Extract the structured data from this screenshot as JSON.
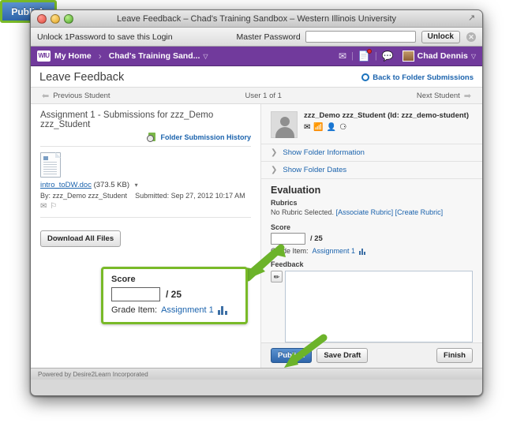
{
  "window": {
    "title": "Leave Feedback – Chad's Training Sandbox – Western Illinois University",
    "resize_icon": "resize-icon",
    "traffic_lights": [
      "close",
      "minimize",
      "zoom"
    ]
  },
  "onepassword_bar": {
    "message": "Unlock 1Password to save this Login",
    "master_password_label": "Master Password",
    "master_password_value": "",
    "unlock_label": "Unlock",
    "close_label": "✕"
  },
  "navbar": {
    "logo_text": "WIU",
    "home_label": "My Home",
    "separator": "›",
    "course_label": "Chad's Training Sand...",
    "course_caret": "▽",
    "icons": [
      "envelope-icon",
      "notifications-icon",
      "chat-icon"
    ],
    "notification_badge": true,
    "user_name": "Chad Dennis",
    "user_caret": "▽",
    "background_color": "#713a9c"
  },
  "page": {
    "title": "Leave Feedback",
    "back_link": "Back to Folder Submissions",
    "student_bar": {
      "previous": "Previous Student",
      "counter": "User 1 of 1",
      "next": "Next Student"
    }
  },
  "left_panel": {
    "assignment_title": "Assignment 1 - Submissions for zzz_Demo zzz_Student",
    "history_link": "Folder Submission History",
    "file_name": "intro_toDW.doc",
    "file_size": "(373.5 KB)",
    "file_caret": "▾",
    "submitted_by": "By: zzz_Demo zzz_Student",
    "submitted_on": "Submitted: Sep 27, 2012 10:17 AM",
    "download_all_label": "Download All Files"
  },
  "right_panel": {
    "student_name": "zzz_Demo zzz_Student (Id: zzz_demo-student)",
    "student_icons": [
      "email-icon",
      "pager-icon",
      "profile-icon",
      "refresh-icon"
    ],
    "show_folder_information": "Show Folder Information",
    "show_folder_dates": "Show Folder Dates",
    "evaluation_heading": "Evaluation",
    "rubrics_label": "Rubrics",
    "no_rubric_text": "No Rubric Selected.",
    "associate_rubric": "[Associate Rubric]",
    "create_rubric": "[Create Rubric]",
    "score_label": "Score",
    "score_value": "",
    "score_max": "/ 25",
    "grade_item_label": "Grade Item:",
    "grade_item_name": "Assignment 1",
    "feedback_label": "Feedback",
    "feedback_value": "",
    "pencil_icon": "pencil-icon",
    "buttons": {
      "publish": "Publish",
      "save_draft": "Save Draft",
      "finish": "Finish"
    }
  },
  "callouts": {
    "score": {
      "heading": "Score",
      "value": "",
      "max": "/ 25",
      "grade_item_label": "Grade Item:",
      "grade_item_name": "Assignment 1",
      "border_color": "#79ba28"
    },
    "publish": {
      "label": "Publish",
      "border_color": "#79ba28",
      "fill_color": "#2f66ab"
    }
  },
  "footer": {
    "text": "Powered by Desire2Learn Incorporated"
  }
}
